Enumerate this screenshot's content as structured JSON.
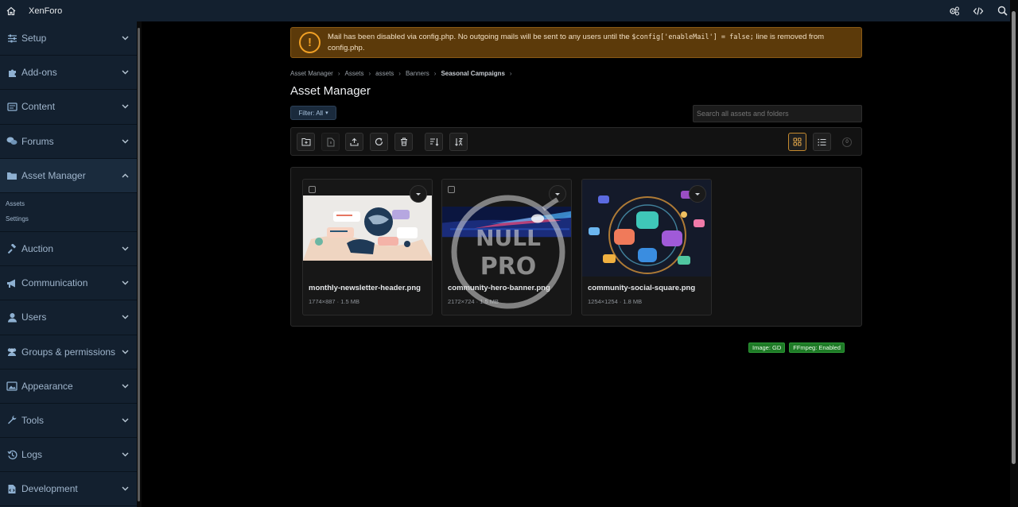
{
  "topbar": {
    "brand": "XenForo"
  },
  "sidebar": {
    "sections": [
      {
        "label": "Setup"
      },
      {
        "label": "Add-ons"
      },
      {
        "label": "Content"
      },
      {
        "label": "Forums"
      },
      {
        "label": "Asset Manager",
        "active": true,
        "children": [
          "Assets",
          "Settings"
        ]
      },
      {
        "label": "Auction"
      },
      {
        "label": "Communication"
      },
      {
        "label": "Users"
      },
      {
        "label": "Groups & permissions"
      },
      {
        "label": "Appearance"
      },
      {
        "label": "Tools"
      },
      {
        "label": "Logs"
      },
      {
        "label": "Development"
      }
    ]
  },
  "notice": {
    "text_before": "Mail has been disabled via config.php. No outgoing mails will be sent to any users until the ",
    "code": "$config['enableMail'] = false;",
    "text_after": " line is removed from config.php."
  },
  "breadcrumbs": [
    "Asset Manager",
    "Assets",
    "assets",
    "Banners",
    "Seasonal Campaigns"
  ],
  "page": {
    "title": "Asset Manager",
    "filter_label": "Filter: All",
    "search_placeholder": "Search all assets and folders",
    "selected_count": "0"
  },
  "assets": [
    {
      "name": "monthly-newsletter-header.png",
      "meta": "1774×887 · 1.5 MB"
    },
    {
      "name": "community-hero-banner.png",
      "meta": "2172×724 · 1.5 MB"
    },
    {
      "name": "community-social-square.png",
      "meta": "1254×1254 · 1.8 MB"
    }
  ],
  "badges": [
    "Image: GD",
    "FFmpeg: Enabled"
  ],
  "watermark": {
    "line1": "NULL",
    "line2": "PRO"
  },
  "colors": {
    "sidebar_bg": "#13202f",
    "accent": "#c58a2e",
    "notice_bg": "#5c3a0a",
    "badge_green": "#1e7a26"
  }
}
